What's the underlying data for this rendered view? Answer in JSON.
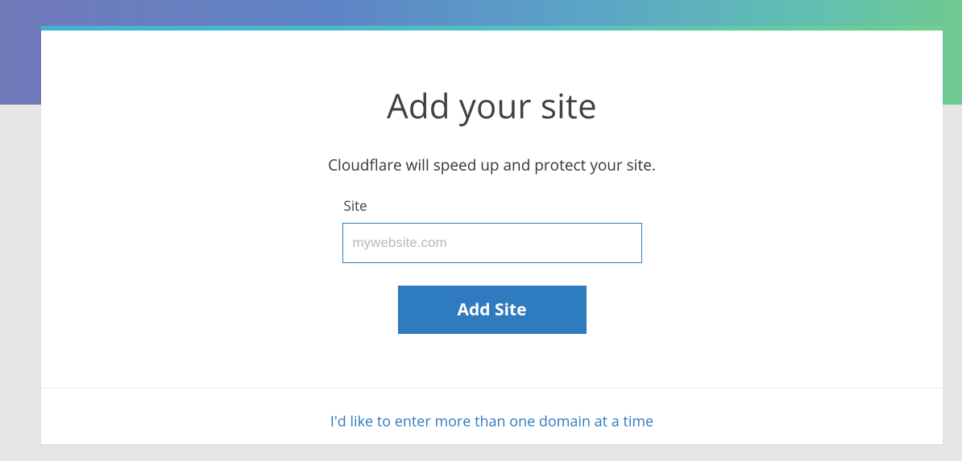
{
  "heading": "Add your site",
  "subtitle": "Cloudflare will speed up and protect your site.",
  "field": {
    "label": "Site",
    "placeholder": "mywebsite.com",
    "value": ""
  },
  "submit_label": "Add Site",
  "multi_domain_link": "I'd like to enter more than one domain at a time"
}
